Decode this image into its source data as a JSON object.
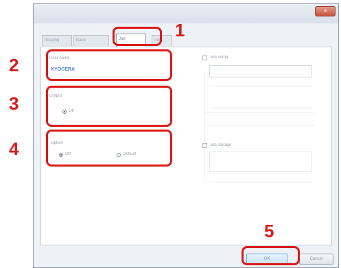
{
  "window": {
    "title": "",
    "close_symbol": "×"
  },
  "tabs": [
    {
      "label": "Imaging"
    },
    {
      "label": "Basic"
    },
    {
      "label": "Job"
    },
    {
      "label": "Info"
    }
  ],
  "left_panel": {
    "user_name_label": "User name",
    "user_name_value": "KYOCERA",
    "output_label": "Output",
    "output_option": "Off",
    "bottom_group_label": "Option",
    "bottom_option_1": "Off",
    "bottom_option_2": "Default"
  },
  "right_panel": {
    "section_1_label": "Job name",
    "section_1_text": "",
    "section_2_label": "",
    "section_3_label": "Job storage"
  },
  "buttons": {
    "ok_label": "OK",
    "cancel_label": "Cancel"
  },
  "callouts": [
    {
      "number": "1"
    },
    {
      "number": "2"
    },
    {
      "number": "3"
    },
    {
      "number": "4"
    },
    {
      "number": "5"
    }
  ],
  "colors": {
    "callout_red": "#dc1a1a",
    "window_bg": "#eef1f5",
    "link_blue": "#4e86d8"
  }
}
